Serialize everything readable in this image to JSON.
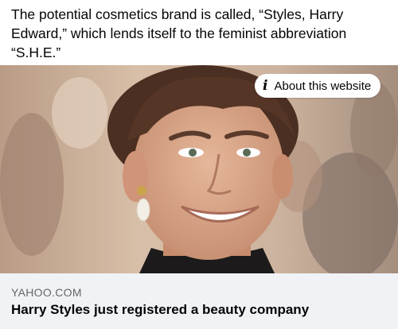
{
  "post": {
    "text": "The potential cosmetics brand is called, “Styles, Harry Edward,” which lends itself to the feminist abbreviation “S.H.E.”"
  },
  "link_card": {
    "about_label": "About this website",
    "domain": "YAHOO.COM",
    "headline": "Harry Styles just registered a beauty company",
    "image_icon": "photo-portrait"
  },
  "colors": {
    "footer_bg": "#f0f2f5",
    "domain_text": "#65676b",
    "body_text": "#050505"
  }
}
